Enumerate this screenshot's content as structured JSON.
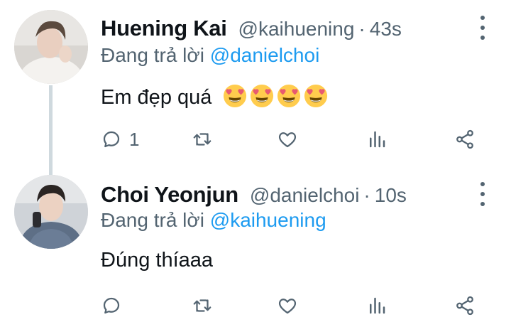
{
  "tweets": [
    {
      "name": "Huening Kai",
      "handle": "@kaihuening",
      "separator": "·",
      "time": "43s",
      "replying_prefix": "Đang trả lời",
      "replying_to": "@danielchoi",
      "text": "Em đẹp quá",
      "emoji_count": 4,
      "reply_count": "1"
    },
    {
      "name": "Choi Yeonjun",
      "handle": "@danielchoi",
      "separator": "·",
      "time": "10s",
      "replying_prefix": "Đang trả lời",
      "replying_to": "@kaihuening",
      "text": "Đúng thíaaa",
      "emoji_count": 0,
      "reply_count": ""
    }
  ],
  "icons": {
    "reply": "reply-icon",
    "retweet": "retweet-icon",
    "like": "heart-icon",
    "views": "analytics-icon",
    "share": "share-icon",
    "more": "more-vertical-icon",
    "emoji": "heart-eyes-emoji-icon"
  },
  "colors": {
    "mention": "#1d9bf0",
    "secondary_text": "#536471",
    "thread_line": "#cfd9de"
  }
}
